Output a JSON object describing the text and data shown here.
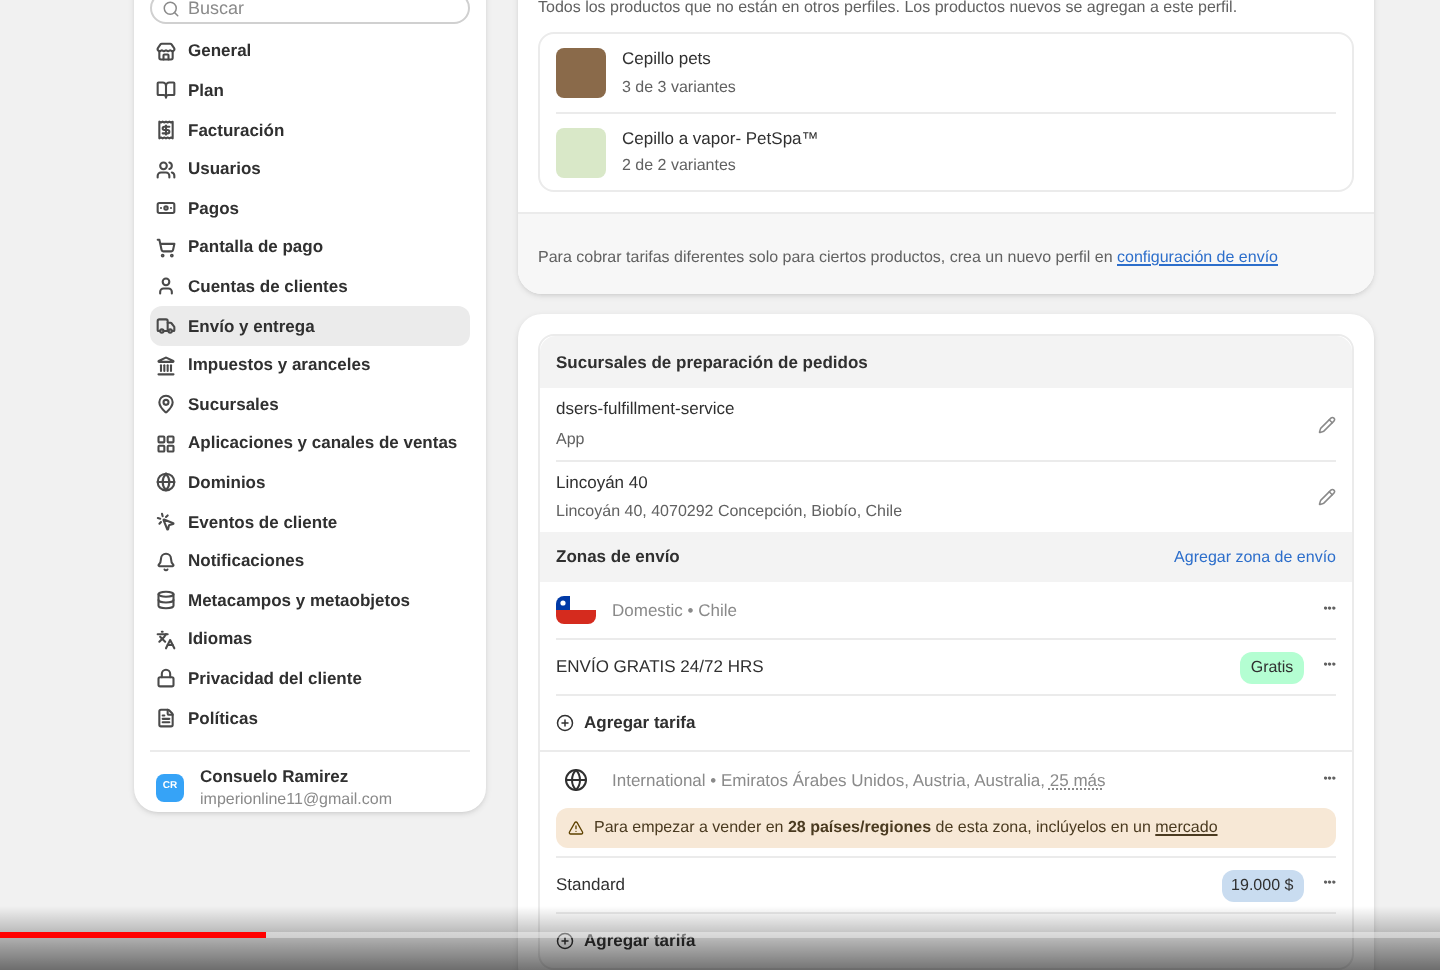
{
  "sidebar": {
    "search": {
      "placeholder": "Buscar"
    },
    "items": [
      {
        "label": "General",
        "selected": false
      },
      {
        "label": "Plan",
        "selected": false
      },
      {
        "label": "Facturación",
        "selected": false
      },
      {
        "label": "Usuarios",
        "selected": false
      },
      {
        "label": "Pagos",
        "selected": false
      },
      {
        "label": "Pantalla de pago",
        "selected": false
      },
      {
        "label": "Cuentas de clientes",
        "selected": false
      },
      {
        "label": "Envío y entrega",
        "selected": true
      },
      {
        "label": "Impuestos y aranceles",
        "selected": false
      },
      {
        "label": "Sucursales",
        "selected": false
      },
      {
        "label": "Aplicaciones y canales de ventas",
        "selected": false
      },
      {
        "label": "Dominios",
        "selected": false
      },
      {
        "label": "Eventos de cliente",
        "selected": false
      },
      {
        "label": "Notificaciones",
        "selected": false
      },
      {
        "label": "Metacampos y metaobjetos",
        "selected": false
      },
      {
        "label": "Idiomas",
        "selected": false
      },
      {
        "label": "Privacidad del cliente",
        "selected": false
      },
      {
        "label": "Políticas",
        "selected": false
      }
    ],
    "user": {
      "initials": "CR",
      "name": "Consuelo Ramirez",
      "email": "imperionline11@gmail.com"
    }
  },
  "profile": {
    "description": "Todos los productos que no están en otros perfiles. Los productos nuevos se agregan a este perfil.",
    "products": [
      {
        "name": "Cepillo pets",
        "variants": "3 de 3 variantes"
      },
      {
        "name": "Cepillo a vapor- PetSpa™",
        "variants": "2 de 2 variantes"
      }
    ],
    "footer_text": "Para cobrar tarifas diferentes solo para ciertos productos, crea un nuevo perfil en",
    "footer_link": "configuración de envío"
  },
  "locations": {
    "title": "Sucursales de preparación de pedidos",
    "items": [
      {
        "name": "dsers-fulfillment-service",
        "detail": "App"
      },
      {
        "name": "Lincoyán 40",
        "detail": "Lincoyán 40, 4070292 Concepción, Biobío, Chile"
      }
    ]
  },
  "zones": {
    "title": "Zonas de envío",
    "add_link": "Agregar zona de envío",
    "list": [
      {
        "kind": "flag",
        "label": "Domestic • Chile",
        "rates": [
          {
            "name": "ENVÍO GRATIS 24/72 HRS",
            "price": "Gratis",
            "color": "#b4fed2"
          }
        ],
        "add_rate": "Agregar tarifa"
      },
      {
        "kind": "globe",
        "label": "International • Emiratos Árabes Unidos, Austria, Australia,",
        "more": "25 más",
        "warning": "Para empezar a vender en **28 países/regiones** de esta zona, inclúyelos en un",
        "warning_link": "mercado",
        "rates": [
          {
            "name": "Standard",
            "price": "19.000 $",
            "color": "#c9dcf0"
          }
        ],
        "add_rate": "Agregar tarifa"
      }
    ],
    "menu_glyph": "•••"
  },
  "video_progress": {
    "level": 0.185
  }
}
